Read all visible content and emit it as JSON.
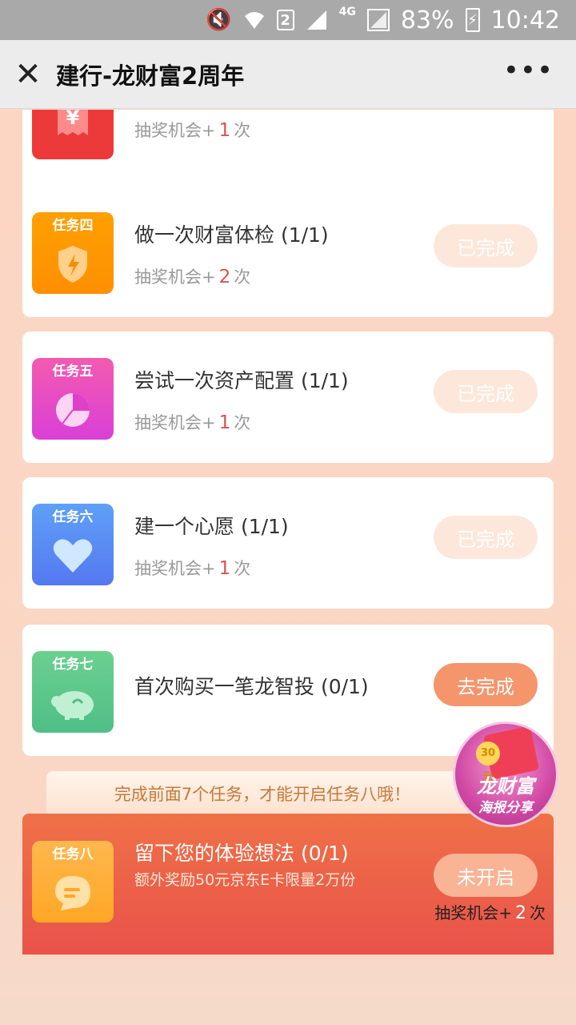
{
  "status_bar": {
    "sim": "2",
    "network": "4G",
    "battery": "83%",
    "time": "10:42"
  },
  "titlebar": {
    "close": "✕",
    "title": "建行-龙财富2周年",
    "more": "•••"
  },
  "tasks": [
    {
      "badge": "",
      "title": "",
      "sub_prefix": "抽奖机会+",
      "count": "1",
      "sub_suffix": "次",
      "button": "",
      "color": "#ec3a3a",
      "icon": "receipt-icon"
    },
    {
      "badge": "任务四",
      "title": "做一次财富体检 (1/1)",
      "sub_prefix": "抽奖机会+",
      "count": "2",
      "sub_suffix": "次",
      "button": "已完成",
      "color": "#fb8c00",
      "icon": "shield-icon"
    },
    {
      "badge": "任务五",
      "title": "尝试一次资产配置 (1/1)",
      "sub_prefix": "抽奖机会+",
      "count": "1",
      "sub_suffix": "次",
      "button": "已完成",
      "color": "#e040c8",
      "icon": "pie-chart-icon"
    },
    {
      "badge": "任务六",
      "title": "建一个心愿 (1/1)",
      "sub_prefix": "抽奖机会+",
      "count": "1",
      "sub_suffix": "次",
      "button": "已完成",
      "color": "#5b8cf5",
      "icon": "heart-icon"
    },
    {
      "badge": "任务七",
      "title": "首次购买一笔龙智投 (0/1)",
      "button": "去完成",
      "color": "#5ec48a",
      "icon": "piggy-bank-icon"
    }
  ],
  "notice": "完成前面7个任务，才能开启任务八哦！",
  "task8": {
    "badge": "任务八",
    "title": "留下您的体验想法 (0/1)",
    "sub": "额外奖励50元京东E卡限量2万份",
    "button": "未开启",
    "chance_prefix": "抽奖机会+",
    "count": "2",
    "chance_suffix": "次",
    "color": "#ffa726",
    "icon": "chat-bubble-icon"
  },
  "float_badge": {
    "line1": "龙财富",
    "line2": "海报分享",
    "coin": "30元"
  }
}
